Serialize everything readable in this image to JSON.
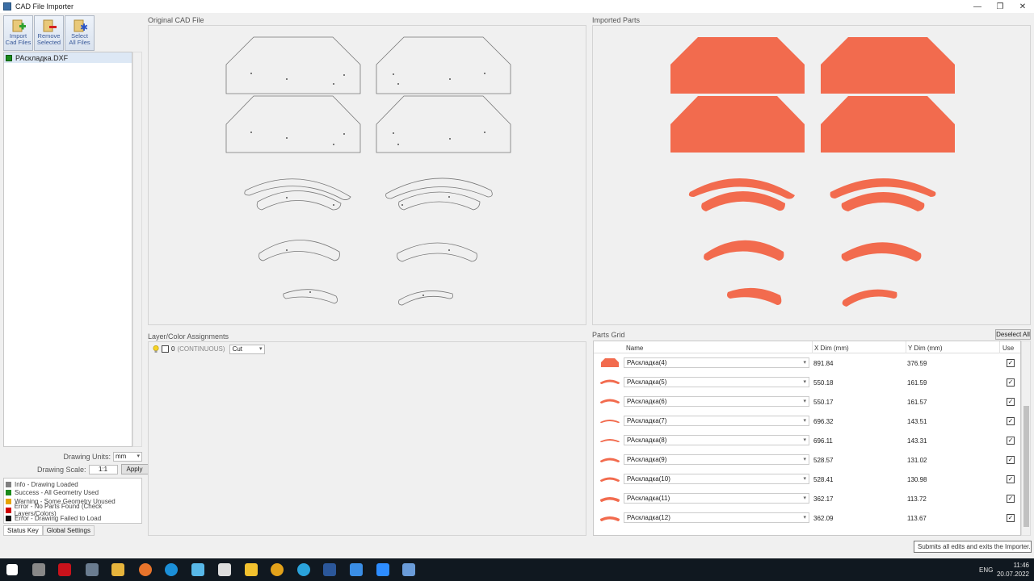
{
  "window": {
    "title": "CAD File Importer"
  },
  "toolbar": {
    "import": [
      "Import",
      "Cad Files"
    ],
    "remove": [
      "Remove",
      "Selected"
    ],
    "select": [
      "Select",
      "All Files"
    ]
  },
  "files": [
    "РАскладка.DXF"
  ],
  "drawing": {
    "units_label": "Drawing Units:",
    "units_value": "mm",
    "scale_label": "Drawing Scale:",
    "scale_value": "1:1",
    "apply_label": "Apply"
  },
  "status_key": [
    {
      "label": "Info - Drawing Loaded",
      "color": "#808080"
    },
    {
      "label": "Success - All Geometry Used",
      "color": "#1a8a1a"
    },
    {
      "label": "Warning - Some Geometry Unused",
      "color": "#e6a400"
    },
    {
      "label": "Error - No Parts Found (Check Layers/Colors)",
      "color": "#d00000"
    },
    {
      "label": "Error - Drawing Failed to Load",
      "color": "#111111"
    }
  ],
  "left_tabs": [
    "Status Key",
    "Global Settings"
  ],
  "panels": {
    "original": "Original CAD File",
    "imported": "Imported Parts",
    "layers": "Layer/Color Assignments",
    "parts_grid": "Parts Grid"
  },
  "layer": {
    "number": "0",
    "type": "(CONTINUOUS)",
    "action": "Cut"
  },
  "grid": {
    "deselect_label": "Deselect All",
    "columns": {
      "name": "Name",
      "x": "X Dim (mm)",
      "y": "Y Dim (mm)",
      "use": "Use"
    },
    "rows": [
      {
        "name": "РАскладка(4)",
        "x": "891.84",
        "y": "376.59",
        "use": true
      },
      {
        "name": "РАскладка(5)",
        "x": "550.18",
        "y": "161.59",
        "use": true
      },
      {
        "name": "РАскладка(6)",
        "x": "550.17",
        "y": "161.57",
        "use": true
      },
      {
        "name": "РАскладка(7)",
        "x": "696.32",
        "y": "143.51",
        "use": true
      },
      {
        "name": "РАскладка(8)",
        "x": "696.11",
        "y": "143.31",
        "use": true
      },
      {
        "name": "РАскладка(9)",
        "x": "528.57",
        "y": "131.02",
        "use": true
      },
      {
        "name": "РАскладка(10)",
        "x": "528.41",
        "y": "130.98",
        "use": true
      },
      {
        "name": "РАскладка(11)",
        "x": "362.17",
        "y": "113.72",
        "use": true
      },
      {
        "name": "РАскладка(12)",
        "x": "362.09",
        "y": "113.67",
        "use": true
      }
    ]
  },
  "tooltip": "Submits all edits and exits the Importer.",
  "taskbar": {
    "lang": "ENG",
    "time": "11:46",
    "date": "20.07.2022"
  },
  "colors": {
    "part_fill": "#f26b4e",
    "accent": "#3b6ea5"
  }
}
